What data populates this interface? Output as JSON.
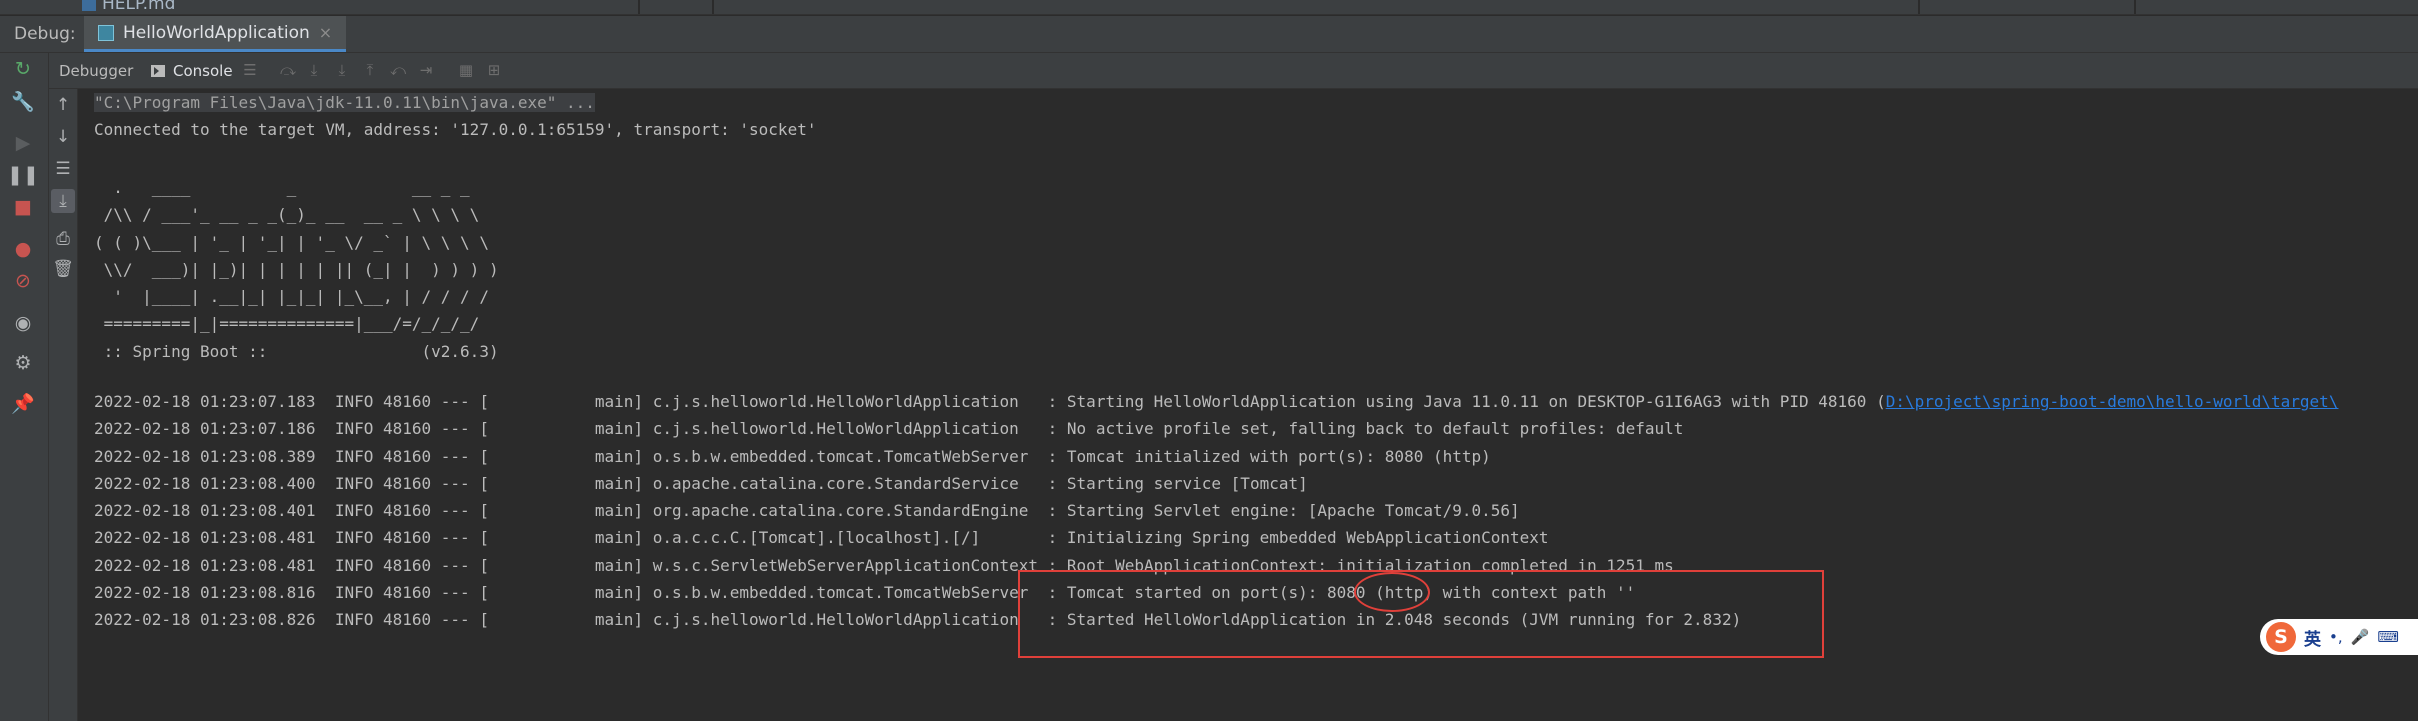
{
  "top_strip": {
    "file_name": "HELP.md"
  },
  "debug_bar": {
    "label": "Debug:",
    "run_tab": "HelloWorldApplication",
    "close_glyph": "×"
  },
  "sub_toolbar": {
    "tabs": [
      {
        "label": "Debugger"
      },
      {
        "label": "Console"
      }
    ]
  },
  "console": {
    "command_line": "\"C:\\Program Files\\Java\\jdk-11.0.11\\bin\\java.exe\" ...",
    "connected": "Connected to the target VM, address: '127.0.0.1:65159', transport: 'socket'",
    "banner": "  .   ____          _            __ _ _\n /\\\\ / ___'_ __ _ _(_)_ __  __ _ \\ \\ \\ \\\n( ( )\\___ | '_ | '_| | '_ \\/ _` | \\ \\ \\ \\\n \\\\/  ___)| |_)| | | | | || (_| |  ) ) ) )\n  '  |____| .__|_| |_|_| |_\\__, | / / / /\n =========|_|==============|___/=/_/_/_/\n :: Spring Boot ::                (v2.6.3)",
    "logs": [
      {
        "text": "2022-02-18 01:23:07.183  INFO 48160 --- [           main] c.j.s.helloworld.HelloWorldApplication   : Starting HelloWorldApplication using Java 11.0.11 on DESKTOP-G1I6AG3 with PID 48160 (",
        "link": "D:\\project\\spring-boot-demo\\hello-world\\target\\"
      },
      {
        "text": "2022-02-18 01:23:07.186  INFO 48160 --- [           main] c.j.s.helloworld.HelloWorldApplication   : No active profile set, falling back to default profiles: default"
      },
      {
        "text": "2022-02-18 01:23:08.389  INFO 48160 --- [           main] o.s.b.w.embedded.tomcat.TomcatWebServer  : Tomcat initialized with port(s): 8080 (http)"
      },
      {
        "text": "2022-02-18 01:23:08.400  INFO 48160 --- [           main] o.apache.catalina.core.StandardService   : Starting service [Tomcat]"
      },
      {
        "text": "2022-02-18 01:23:08.401  INFO 48160 --- [           main] org.apache.catalina.core.StandardEngine  : Starting Servlet engine: [Apache Tomcat/9.0.56]"
      },
      {
        "text": "2022-02-18 01:23:08.481  INFO 48160 --- [           main] o.a.c.c.C.[Tomcat].[localhost].[/]       : Initializing Spring embedded WebApplicationContext"
      },
      {
        "text": "2022-02-18 01:23:08.481  INFO 48160 --- [           main] w.s.c.ServletWebServerApplicationContext : Root WebApplicationContext: initialization completed in 1251 ms"
      },
      {
        "text": "2022-02-18 01:23:08.816  INFO 48160 --- [           main] o.s.b.w.embedded.tomcat.TomcatWebServer  : Tomcat started on port(s): 8080 (http) with context path ''"
      },
      {
        "text": "2022-02-18 01:23:08.826  INFO 48160 --- [           main] c.j.s.helloworld.HelloWorldApplication   : Started HelloWorldApplication in 2.048 seconds (JVM running for 2.832)"
      }
    ]
  },
  "ime": {
    "logo": "S",
    "lang": "英",
    "punct": "•,"
  },
  "colors": {
    "annotation": "#e0403a",
    "link": "#287bde",
    "accent": "#4a88c7"
  }
}
